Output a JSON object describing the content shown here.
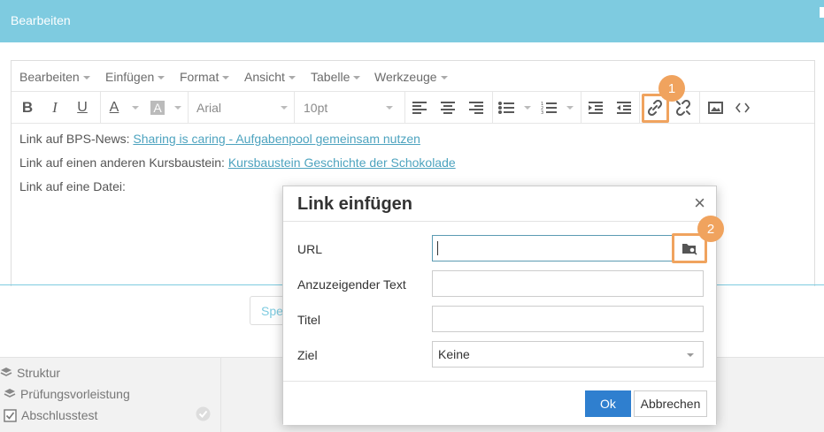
{
  "header": {
    "title": "Bearbeiten"
  },
  "menubar": {
    "items": [
      "Bearbeiten",
      "Einfügen",
      "Format",
      "Ansicht",
      "Tabelle",
      "Werkzeuge"
    ]
  },
  "toolbar": {
    "bold": "B",
    "italic": "I",
    "underline": "U",
    "text_color": "A",
    "bg_color": "A",
    "font_family": "Arial",
    "font_size": "10pt"
  },
  "annotations": {
    "badge_1": "1",
    "badge_2": "2",
    "accent": "#f0a35e"
  },
  "content": {
    "line1_text": "Link auf BPS-News: ",
    "line1_link": "Sharing is caring - Aufgabenpool gemeinsam nutzen",
    "line2_text": "Link auf einen anderen Kursbaustein: ",
    "line2_link": "Kursbaustein Geschichte der Schokolade",
    "line3_text": "Link auf eine Datei:"
  },
  "background_button": {
    "label": "Spe"
  },
  "sidebar": {
    "items": [
      {
        "label": "Struktur",
        "icon": "layers-icon"
      },
      {
        "label": "Prüfungsvorleistung",
        "icon": "layers-icon"
      },
      {
        "label": "Abschlusstest",
        "icon": "checkbox-icon"
      }
    ]
  },
  "dialog": {
    "title": "Link einfügen",
    "close": "×",
    "url_label": "URL",
    "url_value": "",
    "text_label": "Anzuzeigender Text",
    "text_value": "",
    "title_label": "Titel",
    "title_value": "",
    "target_label": "Ziel",
    "target_value": "Keine",
    "ok_label": "Ok",
    "cancel_label": "Abbrechen"
  },
  "colors": {
    "header": "#7ecbe0",
    "primary": "#2f7fcf",
    "link": "#4da3bf"
  }
}
